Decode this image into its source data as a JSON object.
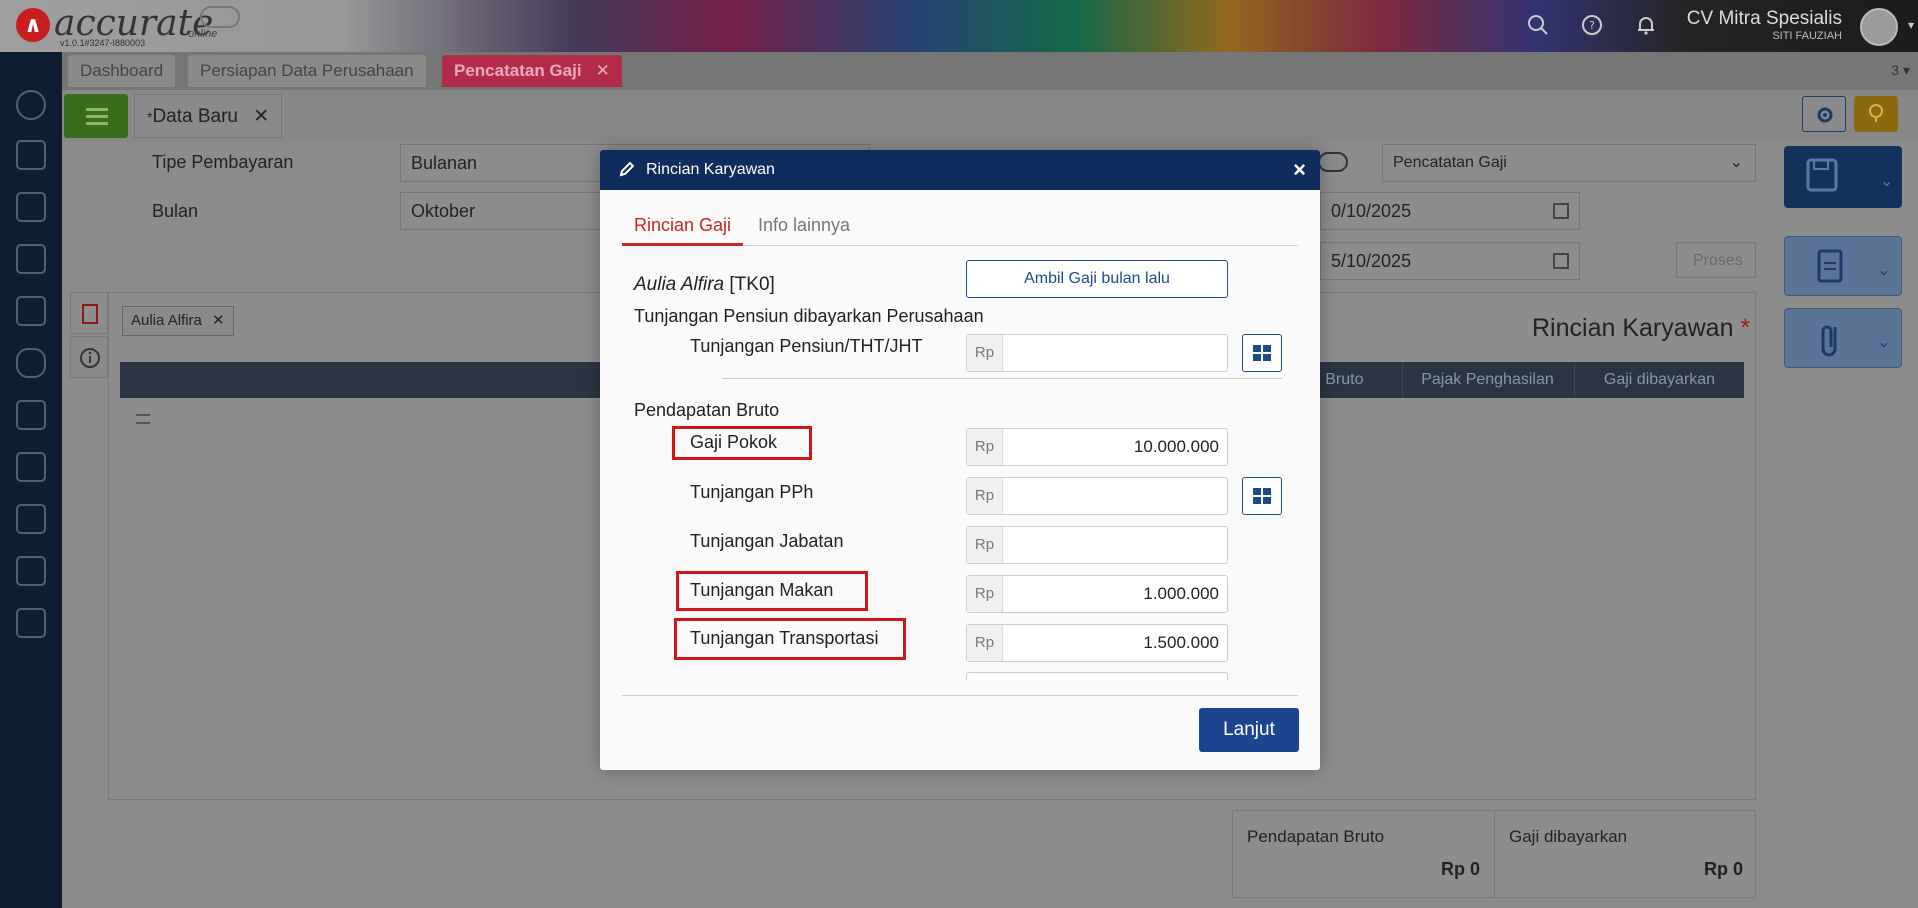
{
  "app": {
    "brand": "accurate",
    "brand_suffix": "online",
    "version": "v1.0.1#3247-I880003",
    "company_name": "CV Mitra Spesialis",
    "user_name": "SITI FAUZIAH"
  },
  "tabs": [
    {
      "label": "Dashboard"
    },
    {
      "label": "Persiapan Data Perusahaan"
    },
    {
      "label": "Pencatatan Gaji",
      "active": true
    }
  ],
  "tab_count": "3",
  "doc_tab": {
    "label": "Data Baru",
    "prefix": "*"
  },
  "form": {
    "tipe_label": "Tipe Pembayaran",
    "tipe_value": "Bulanan",
    "bulan_label": "Bulan",
    "bulan_value": "Oktober",
    "template_value": "Pencatatan Gaji",
    "date1": "0/10/2025",
    "date2": "5/10/2025",
    "proses_label": "Proses"
  },
  "employee_chip": "Aulia Alfira",
  "grid_columns": [
    "an Bruto",
    "Pajak Penghasilan",
    "Gaji dibayarkan"
  ],
  "bg_title": "Rincian Karyawan",
  "summary": {
    "bruto_label": "Pendapatan Bruto",
    "bruto_value": "Rp 0",
    "dibayarkan_label": "Gaji dibayarkan",
    "dibayarkan_value": "Rp 0"
  },
  "modal": {
    "title": "Rincian Karyawan",
    "tabs": [
      "Rincian Gaji",
      "Info lainnya"
    ],
    "employee_name": "Aulia Alfira",
    "employee_code": "[TK0]",
    "ambil_button": "Ambil Gaji bulan lalu",
    "section_pensiun": "Tunjangan Pensiun dibayarkan Perusahaan",
    "section_bruto": "Pendapatan Bruto",
    "currency": "Rp",
    "fields": [
      {
        "label": "Tunjangan Pensiun/THT/JHT",
        "value": ""
      },
      {
        "label": "Gaji Pokok",
        "value": "10.000.000"
      },
      {
        "label": "Tunjangan PPh",
        "value": ""
      },
      {
        "label": "Tunjangan Jabatan",
        "value": ""
      },
      {
        "label": "Tunjangan Makan",
        "value": "1.000.000"
      },
      {
        "label": "Tunjangan Transportasi",
        "value": "1.500.000"
      }
    ],
    "lanjut_button": "Lanjut"
  },
  "colors": {
    "accent_red": "#c8281e",
    "modal_header": "#0f2d5c",
    "primary_button": "#1c4590",
    "highlight": "#d01818"
  }
}
